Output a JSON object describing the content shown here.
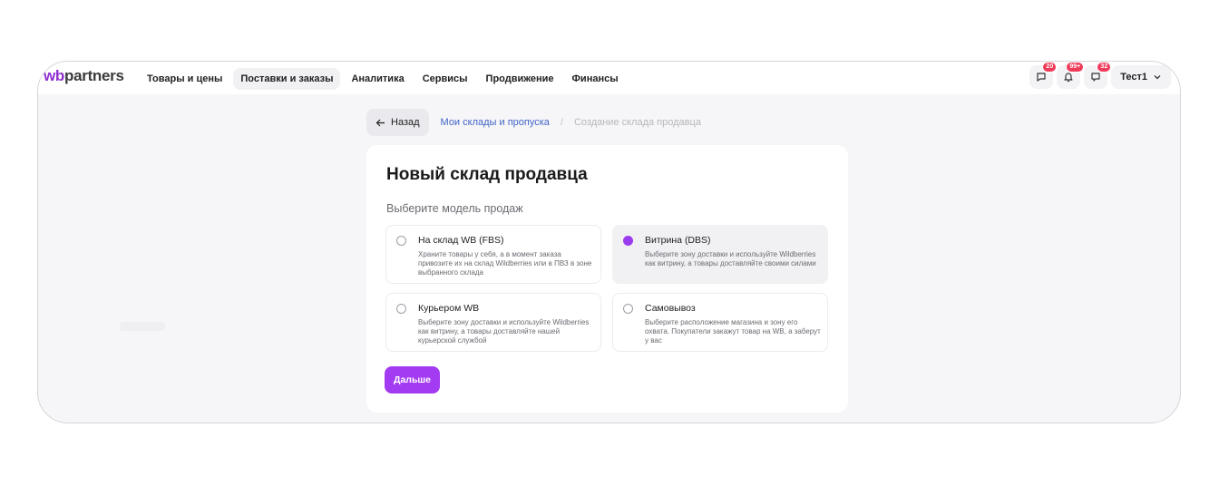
{
  "logo": {
    "wb": "wb",
    "partners": "partners"
  },
  "nav": [
    {
      "label": "Товары и цены",
      "active": false
    },
    {
      "label": "Поставки и заказы",
      "active": true
    },
    {
      "label": "Аналитика",
      "active": false
    },
    {
      "label": "Сервисы",
      "active": false
    },
    {
      "label": "Продвижение",
      "active": false
    },
    {
      "label": "Финансы",
      "active": false
    }
  ],
  "tools": {
    "chat_badge": "20",
    "bell_badge": "99+",
    "support_badge": "32",
    "user_name": "Тест1"
  },
  "breadcrumbs": {
    "back_label": "Назад",
    "link": "Мои склады и пропуска",
    "separator": "/",
    "current": "Создание склада продавца"
  },
  "card": {
    "title": "Новый склад продавца",
    "subtitle": "Выберите модель продаж",
    "options": [
      {
        "title": "На склад WB (FBS)",
        "description": "Храните товары у себя, а в момент заказа привозите их на склад Wildberries или в ПВЗ в зоне выбранного склада",
        "selected": false
      },
      {
        "title": "Витрина (DBS)",
        "description": "Выберите зону доставки и используйте Wildberries как витрину, а товары доставляйте своими силами",
        "selected": true
      },
      {
        "title": "Курьером WB",
        "description": "Выберите зону доставки и используйте Wildberries как витрину, а товары доставляйте нашей курьерской службой",
        "selected": false
      },
      {
        "title": "Самовывоз",
        "description": "Выберите расположение магазина и зону его охвата. Покупатели закажут товар на WB, а заберут у вас",
        "selected": false
      }
    ],
    "next_label": "Дальше"
  },
  "colors": {
    "accent": "#a33bf2",
    "link": "#4164c7",
    "badge": "#ef3b5a"
  }
}
